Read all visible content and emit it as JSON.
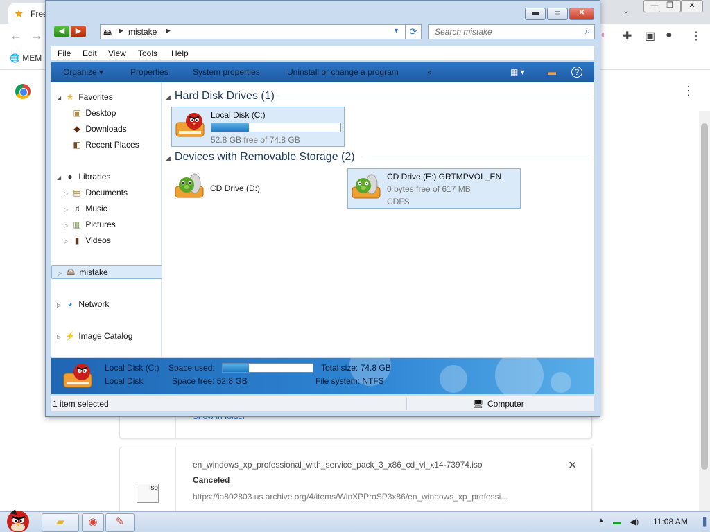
{
  "chrome": {
    "tab_title": "Free",
    "bookmark": "MEM",
    "window_controls": [
      "—",
      "❐",
      "✕"
    ]
  },
  "downloads": {
    "show_in_folder": "Show in folder",
    "item": {
      "filename": "en_windows_xp_professional_with_service_pack_3_x86_cd_vl_x14-73974.iso",
      "status": "Canceled",
      "url": "https://ia802803.us.archive.org/4/items/WinXPProSP3x86/en_windows_xp_professi...",
      "file_icon_label": "iso"
    }
  },
  "explorer": {
    "address": {
      "crumb": "mistake"
    },
    "search_placeholder": "Search mistake",
    "menu": [
      "File",
      "Edit",
      "View",
      "Tools",
      "Help"
    ],
    "commands": [
      "Organize ▾",
      "Properties",
      "System properties",
      "Uninstall or change a program",
      "»"
    ],
    "nav": {
      "favorites": "Favorites",
      "desktop": "Desktop",
      "downloads": "Downloads",
      "recent": "Recent Places",
      "libraries": "Libraries",
      "documents": "Documents",
      "music": "Music",
      "pictures": "Pictures",
      "videos": "Videos",
      "computer": "mistake",
      "network": "Network",
      "image_catalog": "Image Catalog"
    },
    "groups": {
      "hdd": "Hard Disk Drives (1)",
      "removable": "Devices with Removable Storage (2)"
    },
    "drives": {
      "c": {
        "name": "Local Disk (C:)",
        "free": "52.8 GB free of 74.8 GB",
        "used_fraction": 0.29
      },
      "d": {
        "name": "CD Drive (D:)"
      },
      "e": {
        "name": "CD Drive (E:) GRTMPVOL_EN",
        "free": "0 bytes free of 617 MB",
        "fs": "CDFS"
      }
    },
    "details": {
      "name": "Local Disk (C:)",
      "type": "Local Disk",
      "space_used_label": "Space used:",
      "space_free": "Space free: 52.8 GB",
      "total_size": "Total size: 74.8 GB",
      "file_system": "File system: NTFS",
      "used_fraction": 0.29
    },
    "status": {
      "selected": "1 item selected",
      "location": "Computer"
    }
  },
  "taskbar": {
    "clock": "11:08 AM"
  },
  "colors": {
    "command_bar": "#2f78c4",
    "selection": "#dbeaf9",
    "progress": "#1f7ac0"
  }
}
